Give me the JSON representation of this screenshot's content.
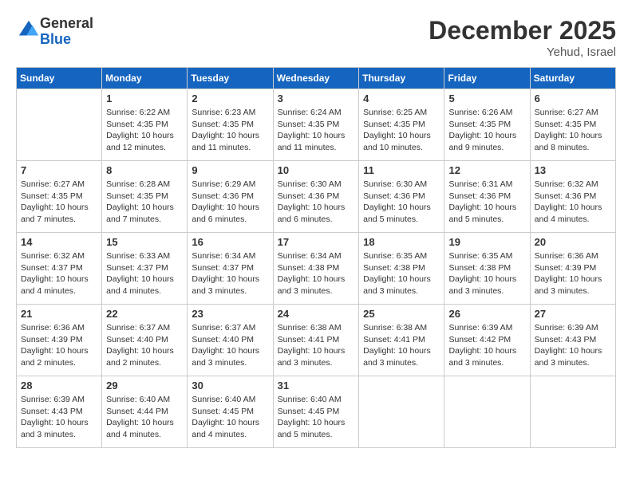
{
  "logo": {
    "general": "General",
    "blue": "Blue"
  },
  "header": {
    "month": "December 2025",
    "location": "Yehud, Israel"
  },
  "days_of_week": [
    "Sunday",
    "Monday",
    "Tuesday",
    "Wednesday",
    "Thursday",
    "Friday",
    "Saturday"
  ],
  "weeks": [
    [
      {
        "day": "",
        "info": ""
      },
      {
        "day": "1",
        "info": "Sunrise: 6:22 AM\nSunset: 4:35 PM\nDaylight: 10 hours and 12 minutes."
      },
      {
        "day": "2",
        "info": "Sunrise: 6:23 AM\nSunset: 4:35 PM\nDaylight: 10 hours and 11 minutes."
      },
      {
        "day": "3",
        "info": "Sunrise: 6:24 AM\nSunset: 4:35 PM\nDaylight: 10 hours and 11 minutes."
      },
      {
        "day": "4",
        "info": "Sunrise: 6:25 AM\nSunset: 4:35 PM\nDaylight: 10 hours and 10 minutes."
      },
      {
        "day": "5",
        "info": "Sunrise: 6:26 AM\nSunset: 4:35 PM\nDaylight: 10 hours and 9 minutes."
      },
      {
        "day": "6",
        "info": "Sunrise: 6:27 AM\nSunset: 4:35 PM\nDaylight: 10 hours and 8 minutes."
      }
    ],
    [
      {
        "day": "7",
        "info": "Sunrise: 6:27 AM\nSunset: 4:35 PM\nDaylight: 10 hours and 7 minutes."
      },
      {
        "day": "8",
        "info": "Sunrise: 6:28 AM\nSunset: 4:35 PM\nDaylight: 10 hours and 7 minutes."
      },
      {
        "day": "9",
        "info": "Sunrise: 6:29 AM\nSunset: 4:36 PM\nDaylight: 10 hours and 6 minutes."
      },
      {
        "day": "10",
        "info": "Sunrise: 6:30 AM\nSunset: 4:36 PM\nDaylight: 10 hours and 6 minutes."
      },
      {
        "day": "11",
        "info": "Sunrise: 6:30 AM\nSunset: 4:36 PM\nDaylight: 10 hours and 5 minutes."
      },
      {
        "day": "12",
        "info": "Sunrise: 6:31 AM\nSunset: 4:36 PM\nDaylight: 10 hours and 5 minutes."
      },
      {
        "day": "13",
        "info": "Sunrise: 6:32 AM\nSunset: 4:36 PM\nDaylight: 10 hours and 4 minutes."
      }
    ],
    [
      {
        "day": "14",
        "info": "Sunrise: 6:32 AM\nSunset: 4:37 PM\nDaylight: 10 hours and 4 minutes."
      },
      {
        "day": "15",
        "info": "Sunrise: 6:33 AM\nSunset: 4:37 PM\nDaylight: 10 hours and 4 minutes."
      },
      {
        "day": "16",
        "info": "Sunrise: 6:34 AM\nSunset: 4:37 PM\nDaylight: 10 hours and 3 minutes."
      },
      {
        "day": "17",
        "info": "Sunrise: 6:34 AM\nSunset: 4:38 PM\nDaylight: 10 hours and 3 minutes."
      },
      {
        "day": "18",
        "info": "Sunrise: 6:35 AM\nSunset: 4:38 PM\nDaylight: 10 hours and 3 minutes."
      },
      {
        "day": "19",
        "info": "Sunrise: 6:35 AM\nSunset: 4:38 PM\nDaylight: 10 hours and 3 minutes."
      },
      {
        "day": "20",
        "info": "Sunrise: 6:36 AM\nSunset: 4:39 PM\nDaylight: 10 hours and 3 minutes."
      }
    ],
    [
      {
        "day": "21",
        "info": "Sunrise: 6:36 AM\nSunset: 4:39 PM\nDaylight: 10 hours and 2 minutes."
      },
      {
        "day": "22",
        "info": "Sunrise: 6:37 AM\nSunset: 4:40 PM\nDaylight: 10 hours and 2 minutes."
      },
      {
        "day": "23",
        "info": "Sunrise: 6:37 AM\nSunset: 4:40 PM\nDaylight: 10 hours and 3 minutes."
      },
      {
        "day": "24",
        "info": "Sunrise: 6:38 AM\nSunset: 4:41 PM\nDaylight: 10 hours and 3 minutes."
      },
      {
        "day": "25",
        "info": "Sunrise: 6:38 AM\nSunset: 4:41 PM\nDaylight: 10 hours and 3 minutes."
      },
      {
        "day": "26",
        "info": "Sunrise: 6:39 AM\nSunset: 4:42 PM\nDaylight: 10 hours and 3 minutes."
      },
      {
        "day": "27",
        "info": "Sunrise: 6:39 AM\nSunset: 4:43 PM\nDaylight: 10 hours and 3 minutes."
      }
    ],
    [
      {
        "day": "28",
        "info": "Sunrise: 6:39 AM\nSunset: 4:43 PM\nDaylight: 10 hours and 3 minutes."
      },
      {
        "day": "29",
        "info": "Sunrise: 6:40 AM\nSunset: 4:44 PM\nDaylight: 10 hours and 4 minutes."
      },
      {
        "day": "30",
        "info": "Sunrise: 6:40 AM\nSunset: 4:45 PM\nDaylight: 10 hours and 4 minutes."
      },
      {
        "day": "31",
        "info": "Sunrise: 6:40 AM\nSunset: 4:45 PM\nDaylight: 10 hours and 5 minutes."
      },
      {
        "day": "",
        "info": ""
      },
      {
        "day": "",
        "info": ""
      },
      {
        "day": "",
        "info": ""
      }
    ]
  ]
}
